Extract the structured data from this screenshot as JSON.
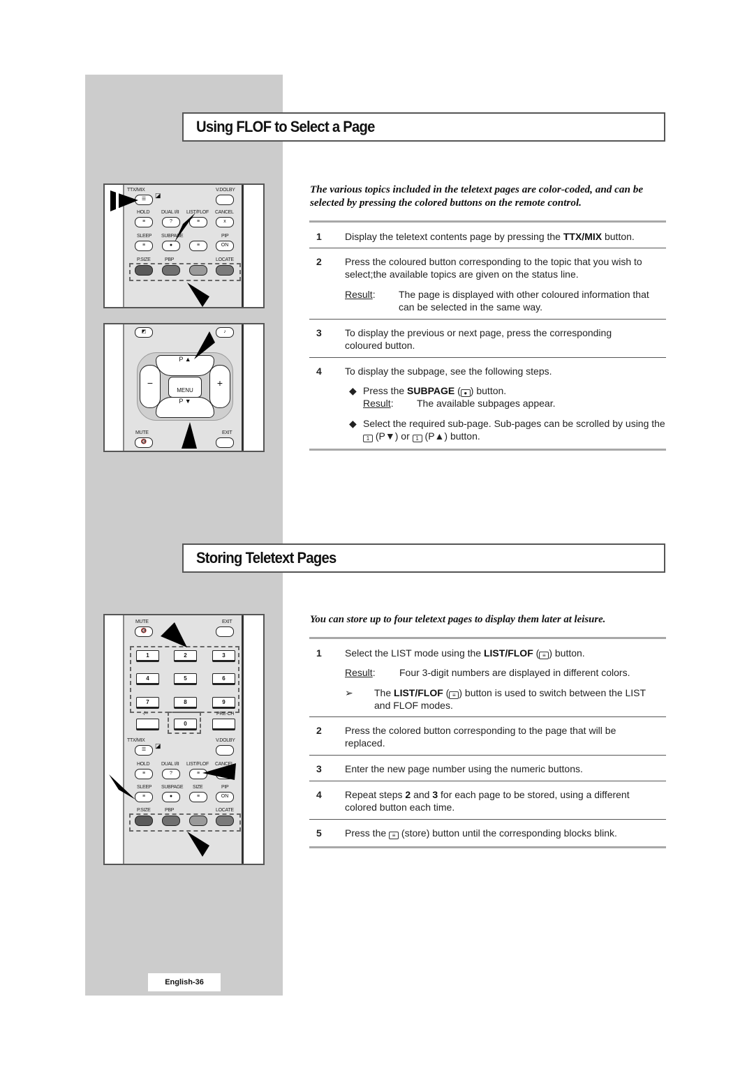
{
  "page": {
    "footer_label": "English-36"
  },
  "section1": {
    "title": "Using FLOF to Select a Page",
    "intro": "The various topics included in the teletext pages are color-coded, and can be selected by pressing the colored buttons on the remote control.",
    "steps": [
      {
        "num": "1",
        "pre": "Display the teletext contents page by pressing the ",
        "bold": "TTX/MIX",
        "post": " button."
      },
      {
        "num": "2",
        "text": "Press the coloured button corresponding to the topic that you wish to select;the available topics are given on the status line.",
        "result_label": "Result",
        "result_text": "The page is displayed with other coloured information that can be selected in the same way."
      },
      {
        "num": "3",
        "text": "To display the previous or next page, press the corresponding coloured button."
      },
      {
        "num": "4",
        "text": "To display the subpage, see the following steps.",
        "bullets": [
          {
            "pre": "Press the ",
            "bold": "SUBPAGE",
            "icon": "subpage-icon",
            "post": " button.",
            "result_label": "Result",
            "result_text": "The available subpages appear."
          },
          {
            "text": "Select the required sub-page. Sub-pages can be scrolled by using the",
            "icon1": "page-down-icon",
            "mid1": " (P▼) or ",
            "icon2": "page-up-icon",
            "mid2": " (P▲) button."
          }
        ]
      }
    ],
    "remote_top": {
      "labels": {
        "ttx": "TTX/MIX",
        "vdolby": "V.DOLBY",
        "hold": "HOLD",
        "dual": "DUAL I/II",
        "list": "LIST/FLOF",
        "cancel": "CANCEL",
        "sleep": "SLEEP",
        "subpage": "SUBPAGE",
        "pip": "PIP",
        "psize": "P.SIZE",
        "pbp": "PBP",
        "locate": "LOCATE",
        "on": "ON"
      },
      "colored_buttons": [
        "#5a5a5a",
        "#707070",
        "#9a9a9a",
        "#7a7a7a"
      ]
    },
    "remote_nav": {
      "labels": {
        "menu": "MENU",
        "p": "P",
        "minus": "−",
        "plus": "+",
        "mute": "MUTE",
        "exit": "EXIT"
      }
    }
  },
  "section2": {
    "title": "Storing Teletext Pages",
    "intro": "You can store up to four teletext pages to display them later at leisure.",
    "steps": [
      {
        "num": "1",
        "pre": "Select the LIST mode using the ",
        "bold": "LIST/FLOF",
        "icon": "list-flof-icon",
        "post": " button.",
        "result_label": "Result",
        "result_text": "Four 3-digit numbers are displayed in different colors.",
        "note_pre": "The ",
        "note_bold": "LIST/FLOF",
        "note_post": " button is used to switch between the LIST and FLOF modes."
      },
      {
        "num": "2",
        "text": "Press the colored button corresponding to the page that will be replaced."
      },
      {
        "num": "3",
        "text": "Enter the new page number using the numeric buttons."
      },
      {
        "num": "4",
        "pre": "Repeat steps ",
        "b1": "2",
        "mid": " and ",
        "b2": "3",
        "post": " for each page to be stored, using a different colored button each time."
      },
      {
        "num": "5",
        "pre": "Press the ",
        "icon": "store-icon",
        "post": " (store) button until the corresponding blocks blink."
      }
    ],
    "remote_numpad": {
      "labels": {
        "mute": "MUTE",
        "exit": "EXIT",
        "dash": "-/--",
        "prech": "PRE-CH"
      },
      "digits": [
        "1",
        "2",
        "3",
        "4",
        "5",
        "6",
        "7",
        "8",
        "9",
        "0"
      ]
    },
    "remote_bottom": {
      "labels": {
        "ttx": "TTX/MIX",
        "vdolby": "V.DOLBY",
        "hold": "HOLD",
        "dual": "DUAL I/II",
        "list": "LIST/FLOF",
        "cancel": "CANCEL",
        "sleep": "SLEEP",
        "subpage": "SUBPAGE",
        "size": "SIZE",
        "pip": "PIP",
        "psize": "P.SIZE",
        "pbp": "PBP",
        "locate": "LOCATE",
        "on": "ON"
      }
    }
  }
}
